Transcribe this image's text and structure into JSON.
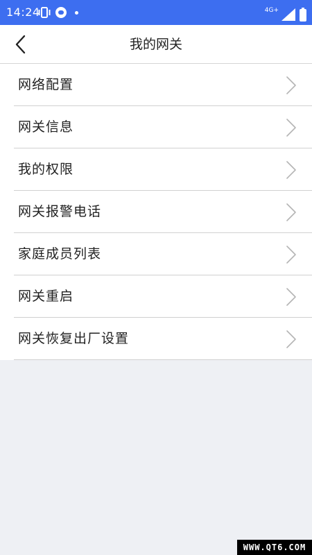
{
  "status_bar": {
    "time": "14:24",
    "network_type": "4G+",
    "icons": [
      "vibrate-icon",
      "weather-icon",
      "dot-icon",
      "signal-icon",
      "battery-icon"
    ]
  },
  "header": {
    "title": "我的网关",
    "back_icon": "chevron-left-icon"
  },
  "menu": {
    "items": [
      {
        "label": "网络配置"
      },
      {
        "label": "网关信息"
      },
      {
        "label": "我的权限"
      },
      {
        "label": "网关报警电话"
      },
      {
        "label": "家庭成员列表"
      },
      {
        "label": "网关重启"
      },
      {
        "label": "网关恢复出厂设置"
      }
    ]
  },
  "watermark": {
    "text": "WWW.QT6.COM"
  },
  "colors": {
    "status_bar": "#3d6ef0",
    "page_background": "#eef0f4",
    "list_background": "#ffffff",
    "divider": "#d0d0d0",
    "text": "#222222",
    "chevron": "#b5b5b5"
  }
}
